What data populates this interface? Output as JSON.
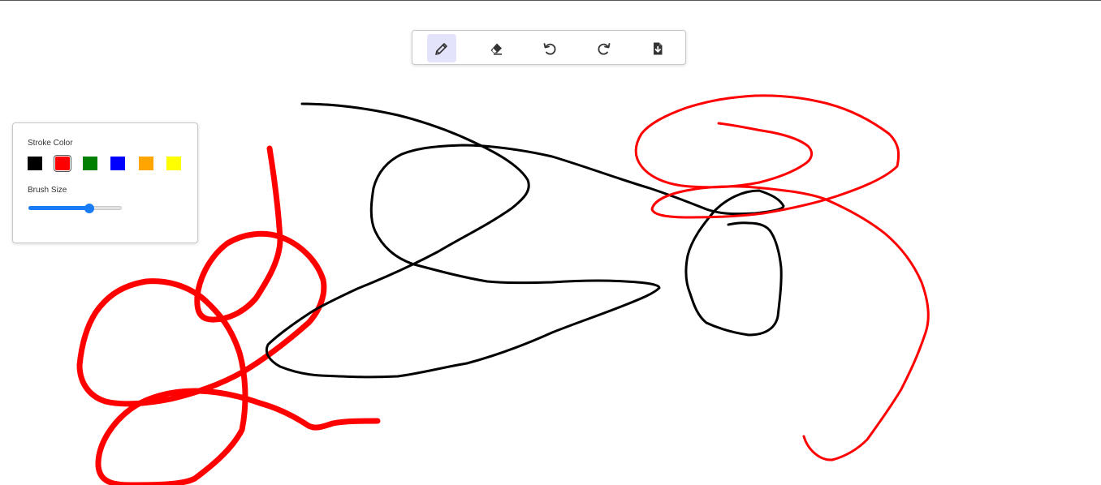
{
  "toolbar": {
    "tools": [
      {
        "name": "pencil",
        "icon": "pencil-icon",
        "active": true
      },
      {
        "name": "eraser",
        "icon": "eraser-icon",
        "active": false
      },
      {
        "name": "undo",
        "icon": "undo-icon",
        "active": false
      },
      {
        "name": "redo",
        "icon": "redo-icon",
        "active": false
      },
      {
        "name": "download",
        "icon": "file-download-icon",
        "active": false
      }
    ],
    "active_color": "#e3e3fb"
  },
  "panel": {
    "stroke_color_label": "Stroke Color",
    "brush_size_label": "Brush Size",
    "colors": [
      "#000000",
      "#ff0000",
      "#008000",
      "#0000ff",
      "#ffa500",
      "#ffff00"
    ],
    "selected_color": "#ff0000",
    "brush_size_fraction": 0.65,
    "slider_color": "#1a7cf5"
  },
  "strokes": [
    {
      "color": "#ff0000",
      "width": "thick"
    },
    {
      "color": "#ff0000",
      "width": "thick"
    },
    {
      "color": "#ff0000",
      "width": "thick"
    },
    {
      "color": "#ff0000",
      "width": "thick"
    },
    {
      "color": "#000000",
      "width": "medium"
    },
    {
      "color": "#000000",
      "width": "medium"
    },
    {
      "color": "#000000",
      "width": "medium"
    },
    {
      "color": "#ff0000",
      "width": "medium"
    },
    {
      "color": "#ff0000",
      "width": "medium"
    },
    {
      "color": "#000000",
      "width": "medium"
    }
  ]
}
